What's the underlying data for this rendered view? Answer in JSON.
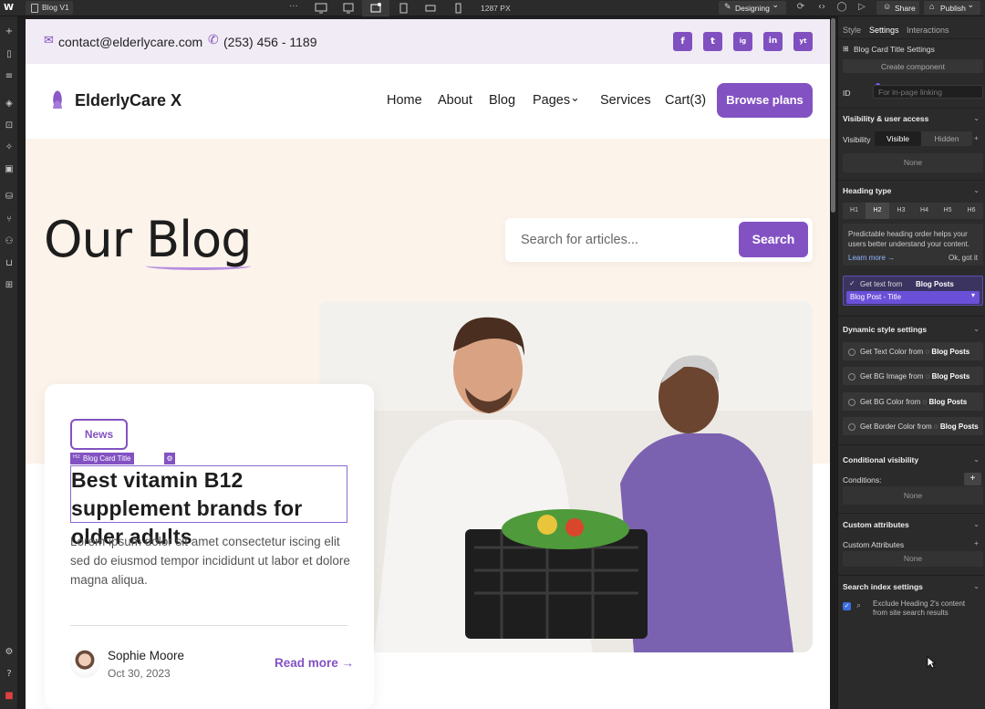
{
  "topbar": {
    "page_name": "Blog V1",
    "width_readout": "1287 PX",
    "mode": "Designing",
    "share": "Share",
    "publish": "Publish"
  },
  "site": {
    "contact": {
      "email": "contact@elderlycare.com",
      "phone": "(253) 456 - 1189"
    },
    "social": [
      "f",
      "t",
      "ig",
      "in",
      "yt"
    ],
    "brand": "ElderlyCare X",
    "nav": [
      "Home",
      "About",
      "Blog",
      "Pages",
      "Services",
      "Cart(3)"
    ],
    "cta": "Browse plans",
    "hero": {
      "title_plain": "Our ",
      "title_accent": "Blog",
      "search_placeholder": "Search for articles...",
      "search_button": "Search"
    },
    "card": {
      "badge": "News",
      "selection_label": "Blog Card Title",
      "title": "Best vitamin B12 supplement brands for older adults",
      "excerpt": "Lorem ipsum dolor sit amet consectetur iscing elit sed do eiusmod tempor incididunt ut labor et dolore magna aliqua.",
      "author": "Sophie Moore",
      "date": "Oct 30, 2023",
      "read_more": "Read more →"
    }
  },
  "panel": {
    "tabs": [
      "Style",
      "Settings",
      "Interactions"
    ],
    "element_settings": "Blog Card Title Settings",
    "create_component": "Create component",
    "id_label": "ID",
    "id_placeholder": "For in-page linking",
    "visibility": {
      "title": "Visibility & user access",
      "label": "Visibility",
      "visible": "Visible",
      "hidden": "Hidden",
      "none": "None"
    },
    "heading": {
      "title": "Heading type",
      "levels": [
        "H1",
        "H2",
        "H3",
        "H4",
        "H5",
        "H6"
      ],
      "tip": "Predictable heading order helps your users better understand your content.",
      "learn_more": "Learn more →",
      "ok": "Ok, got it",
      "get_text": "Get text from",
      "source": "Blog Posts",
      "field": "Blog Post - Title"
    },
    "dynamic": {
      "title": "Dynamic style settings",
      "items": [
        {
          "label": "Get Text Color from",
          "source": "Blog Posts"
        },
        {
          "label": "Get BG Image from",
          "source": "Blog Posts"
        },
        {
          "label": "Get BG Color from",
          "source": "Blog Posts"
        },
        {
          "label": "Get Border Color from",
          "source": "Blog Posts"
        }
      ]
    },
    "conditional": {
      "title": "Conditional visibility",
      "conditions": "Conditions:",
      "none": "None"
    },
    "custom_attrs": {
      "title": "Custom attributes",
      "label": "Custom Attributes",
      "none": "None"
    },
    "search_index": {
      "title": "Search index settings",
      "exclude": "Exclude Heading 2's content from site search results"
    }
  },
  "colors": {
    "accent": "#8352c2",
    "hero_bg": "#fcf3ea",
    "contact_bg": "#f1ebf6",
    "editor_bg": "#2b2b2b"
  }
}
